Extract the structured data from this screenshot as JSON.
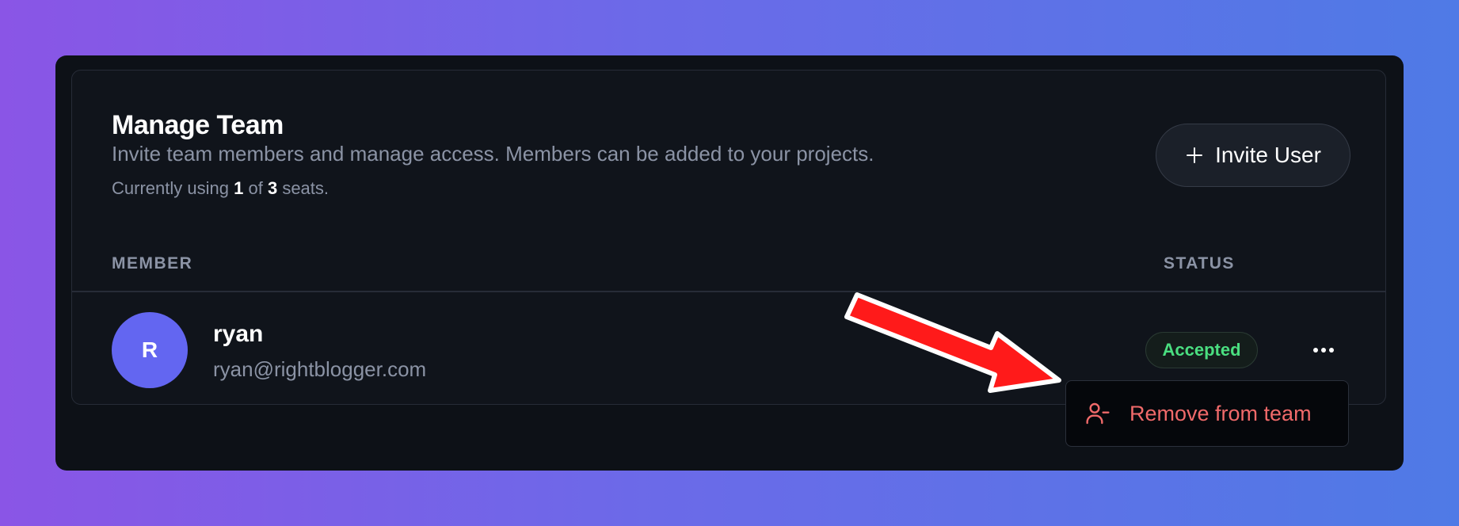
{
  "header": {
    "title": "Manage Team",
    "subtitle": "Invite team members and manage access. Members can be added to your projects.",
    "seats": {
      "prefix": "Currently using",
      "used": "1",
      "of": "of",
      "total": "3",
      "suffix": "seats."
    }
  },
  "invite_button": {
    "icon": "plus-icon",
    "label": "Invite User"
  },
  "table": {
    "columns": [
      "MEMBER",
      "STATUS"
    ],
    "rows": [
      {
        "initial": "R",
        "name": "ryan",
        "email": "ryan@rightblogger.com",
        "status": "Accepted"
      }
    ]
  },
  "row_menu": {
    "icon": "more-horizontal-icon",
    "items": [
      {
        "icon": "user-minus-icon",
        "label": "Remove from team"
      }
    ]
  },
  "annotation": {
    "icon": "red-arrow-icon",
    "color": "#ff1a1a"
  },
  "colors": {
    "background_start": "#8a55e6",
    "background_end": "#4f7ae6",
    "card": "#0d1117",
    "avatar": "#6366f1",
    "status_accepted": "#4ade80",
    "danger": "#f06a6a"
  }
}
